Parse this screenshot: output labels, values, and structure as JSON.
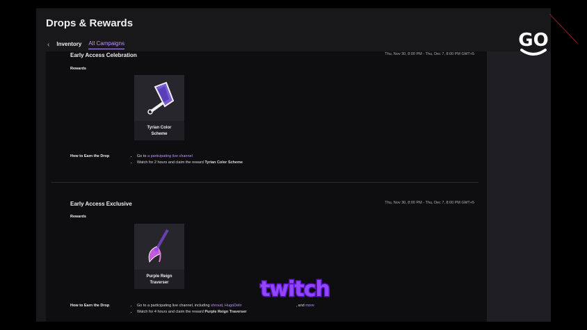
{
  "header": {
    "title": "Drops & Rewards"
  },
  "tabs": [
    {
      "label": "Inventory",
      "active": false
    },
    {
      "label": "All Campaigns",
      "active": true
    }
  ],
  "icons": {
    "back": "chevron-left-icon"
  },
  "accent_color": "#bf94ff",
  "campaigns": [
    {
      "title": "Early Access Celebration",
      "dates": "Thu, Nov 30, 8:00 PM - Thu, Dec 7, 8:00 PM GMT+5",
      "rewards_label": "Rewards",
      "reward": {
        "name_line1": "Tyrian Color",
        "name_line2": "Scheme",
        "icon": "paint-brush-icon"
      },
      "how_label": "How to Earn the Drop",
      "steps": [
        {
          "prefix": "Go to ",
          "link": "a participating live channel"
        },
        {
          "text": "Watch for 2 hours and claim the reward ",
          "bold": "Tyrian Color Scheme"
        }
      ]
    },
    {
      "title": "Early Access Exclusive",
      "dates": "Thu, Nov 30, 8:00 PM - Thu, Dec 7, 8:00 PM GMT+5",
      "rewards_label": "Rewards",
      "reward": {
        "name_line1": "Purple Reign",
        "name_line2": "Traverser",
        "icon": "scythe-weapon-icon"
      },
      "how_label": "How to Earn the Drop",
      "steps": [
        {
          "prefix": "Go to a participating live channel, including ",
          "link1": "shroud",
          "sep": ", ",
          "link2": "HugoDelir",
          "suffix": ", and ",
          "more": "more"
        },
        {
          "text": "Watch for 4 hours and claim the reward ",
          "bold": "Purple Reign Traverser"
        }
      ]
    }
  ],
  "overlays": {
    "go_logo": "GO",
    "twitch_logo": "twitch"
  }
}
